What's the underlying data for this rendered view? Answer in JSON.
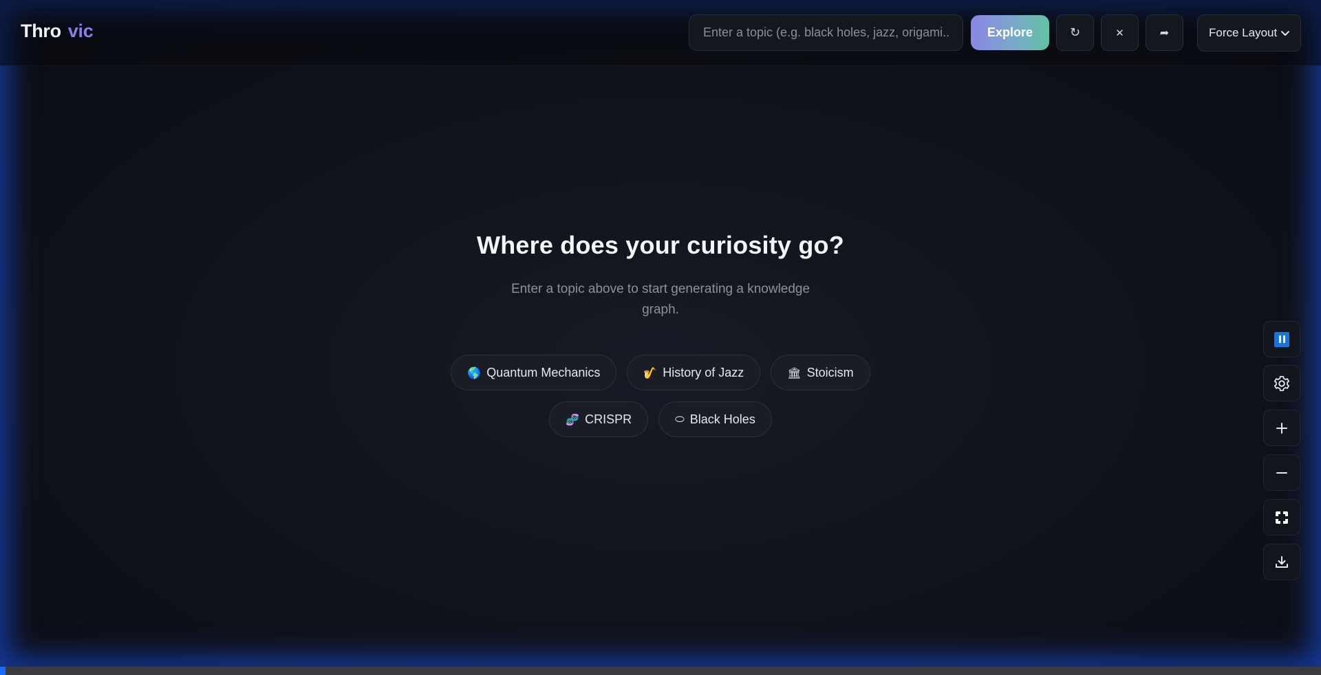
{
  "header": {
    "logo_part1": "Thro",
    "logo_part2": "vic",
    "search_placeholder": "Enter a topic (e.g. black holes, jazz, origami...",
    "explore_label": "Explore",
    "refresh_icon": "↻",
    "clear_icon": "✕",
    "share_icon": "➦",
    "layout_selected": "Force Layout"
  },
  "main": {
    "title": "Where does your curiosity go?",
    "subtitle": "Enter a topic above to start generating a knowledge graph.",
    "chips": [
      {
        "icon": "🌎",
        "label": "Quantum Mechanics"
      },
      {
        "icon": "🎷",
        "label": "History of Jazz"
      },
      {
        "icon": "🏛",
        "label": "Stoicism"
      },
      {
        "icon": "🧬",
        "label": "CRISPR"
      },
      {
        "icon": "⬭",
        "label": "Black Holes"
      }
    ]
  },
  "toolbar": {
    "icons": [
      "pause-icon",
      "gear-icon",
      "plus-icon",
      "minus-icon",
      "fit-view-icon",
      "download-icon"
    ]
  },
  "colors": {
    "accent_purple": "#8f7ee6",
    "explore_gradient_start": "#8b86e6",
    "explore_gradient_end": "#62c2a4",
    "glow_blue": "#1e5aff",
    "pause_blue": "#1e74d6"
  }
}
